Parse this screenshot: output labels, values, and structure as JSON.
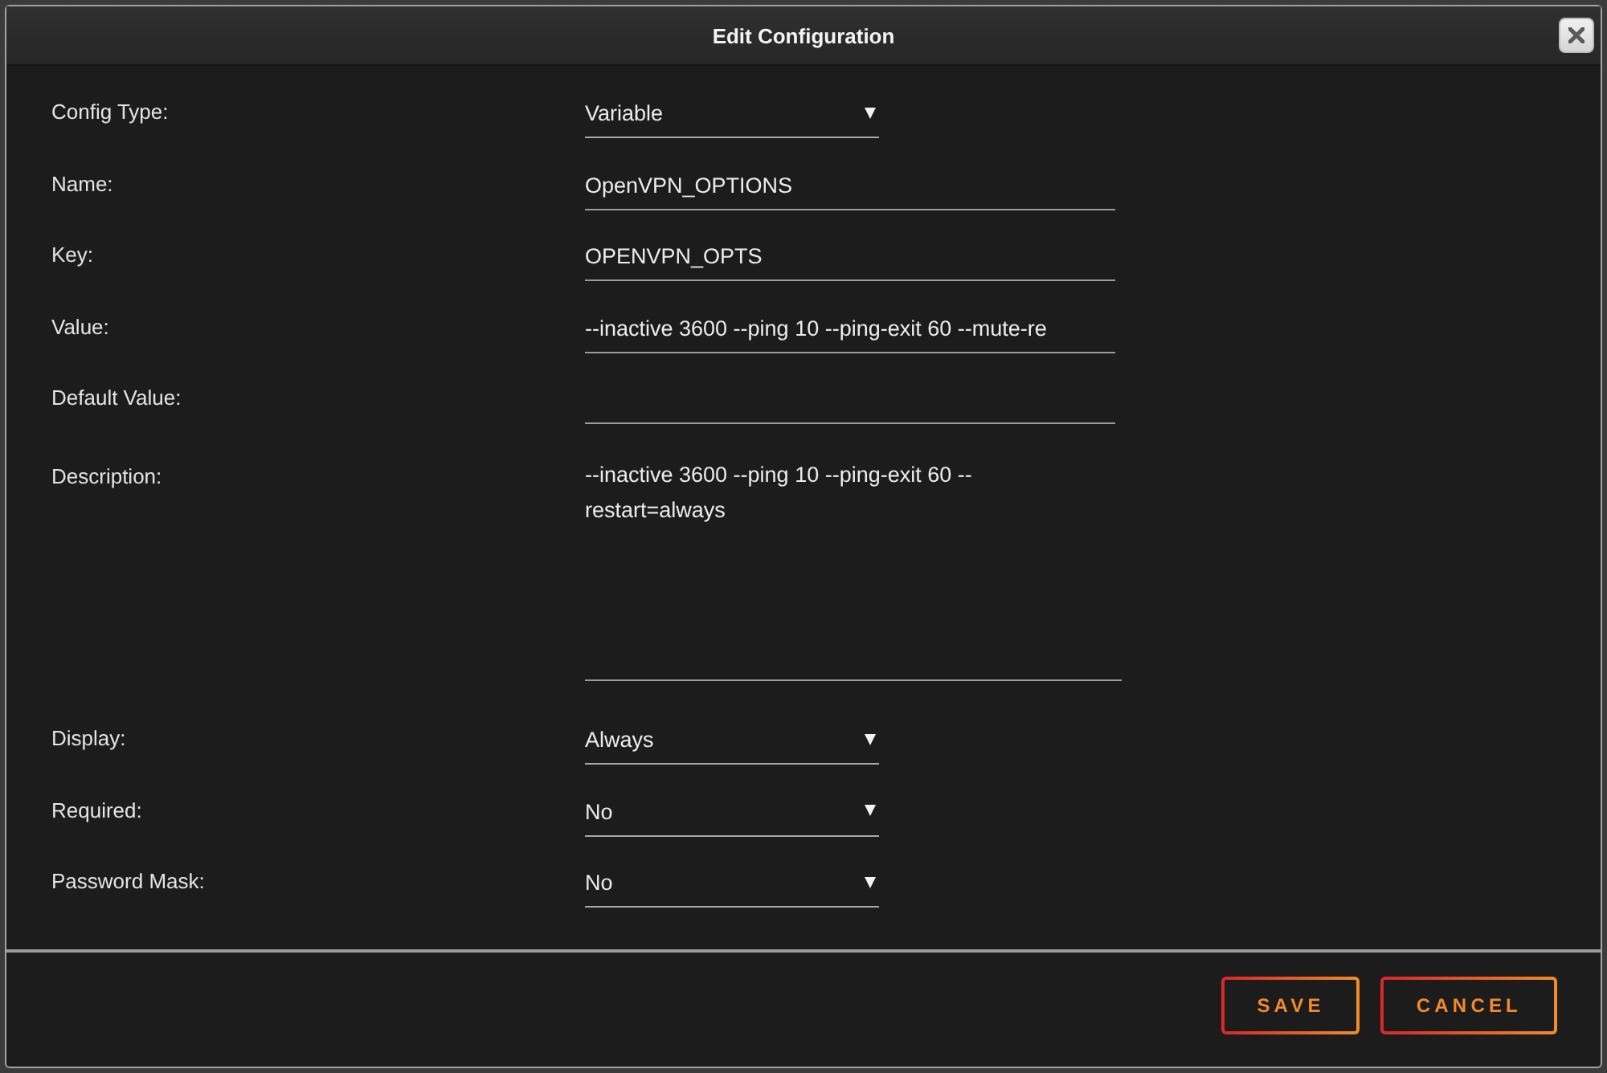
{
  "dialog": {
    "title": "Edit Configuration"
  },
  "fields": [
    {
      "label": "Config Type:",
      "kind": "select",
      "value": "Variable"
    },
    {
      "label": "Name:",
      "kind": "text",
      "value": "OpenVPN_OPTIONS"
    },
    {
      "label": "Key:",
      "kind": "text",
      "value": "OPENVPN_OPTS"
    },
    {
      "label": "Value:",
      "kind": "text",
      "value": "--inactive 3600 --ping 10 --ping-exit 60 --mute-re"
    },
    {
      "label": "Default Value:",
      "kind": "text"
    },
    {
      "label": "Description:",
      "kind": "textarea",
      "value": "--inactive 3600 --ping 10 --ping-exit 60 --restart=always"
    },
    {
      "label": "Display:",
      "kind": "select",
      "value": "Always"
    },
    {
      "label": "Required:",
      "kind": "select",
      "value": "No"
    },
    {
      "label": "Password Mask:",
      "kind": "select",
      "value": "No"
    }
  ],
  "buttons": [
    "SAVE",
    "CANCEL"
  ]
}
